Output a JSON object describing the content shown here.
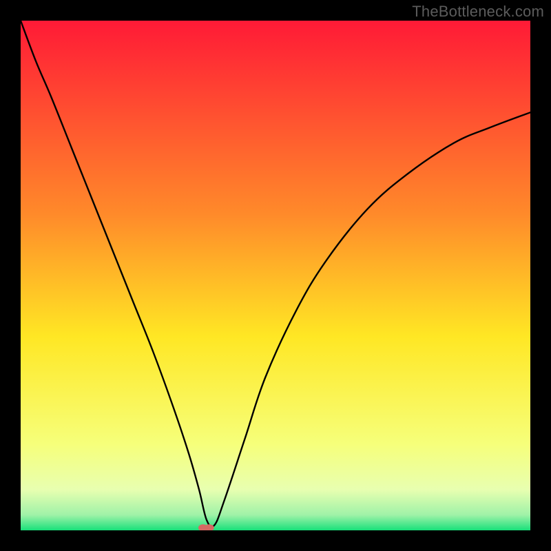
{
  "watermark": "TheBottleneck.com",
  "colors": {
    "top": "#ff1a36",
    "mid_upper": "#ff8a2a",
    "mid": "#ffe724",
    "mid_lower": "#f6ff7a",
    "bottom": "#18e07a",
    "curve": "#000000",
    "marker": "#d56a63"
  },
  "chart_data": {
    "type": "line",
    "title": "",
    "xlabel": "",
    "ylabel": "",
    "xlim": [
      0,
      100
    ],
    "ylim": [
      0,
      100
    ],
    "grid": false,
    "legend": false,
    "annotations": [],
    "series": [
      {
        "name": "bottleneck-curve",
        "x": [
          0,
          3,
          6,
          10,
          14,
          18,
          22,
          26,
          30,
          33,
          35,
          36.5,
          38,
          40,
          44,
          48,
          54,
          60,
          68,
          76,
          85,
          92,
          100
        ],
        "y": [
          100,
          92,
          85,
          75,
          65,
          55,
          45,
          35,
          24,
          15,
          8,
          2,
          1,
          6,
          18,
          30,
          43,
          53,
          63,
          70,
          76,
          79,
          82
        ]
      }
    ],
    "markers": [
      {
        "name": "optimum",
        "x": 37,
        "y": 0.5
      },
      {
        "name": "optimum-trail",
        "x": 35.8,
        "y": 0.5
      }
    ],
    "optimum_x": 37
  }
}
